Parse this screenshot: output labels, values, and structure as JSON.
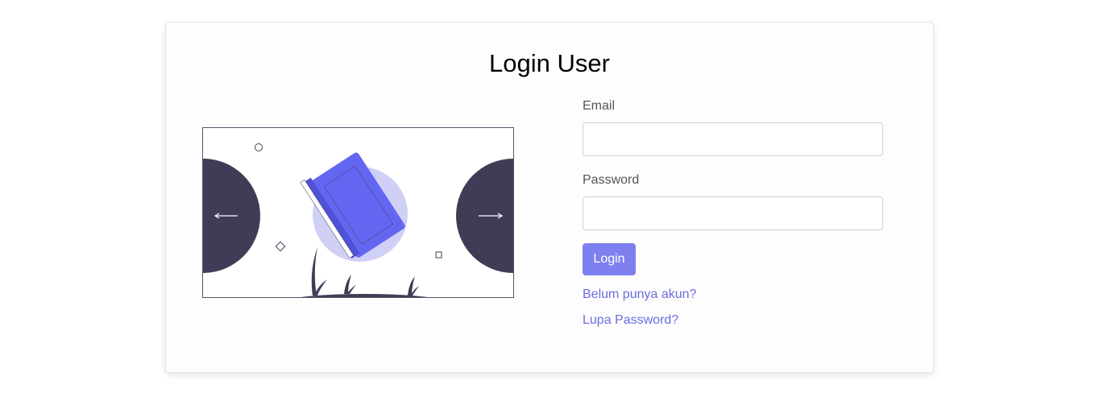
{
  "page": {
    "title": "Login User"
  },
  "form": {
    "email_label": "Email",
    "email_value": "",
    "email_placeholder": "",
    "password_label": "Password",
    "password_value": "",
    "password_placeholder": "",
    "login_label": "Login",
    "register_link": "Belum punya akun?",
    "forgot_link": "Lupa Password?"
  },
  "carousel": {
    "prev_arrow": "⟵",
    "next_arrow": "⟶"
  },
  "colors": {
    "accent": "#7e80ef",
    "link": "#6c6de0",
    "book": "#6366f1",
    "book_circle": "#d0d0f7",
    "dark_shape": "#3f3d56"
  },
  "icons": {
    "prev": "arrow-left-icon",
    "next": "arrow-right-icon",
    "illustration": "book-illustration"
  }
}
